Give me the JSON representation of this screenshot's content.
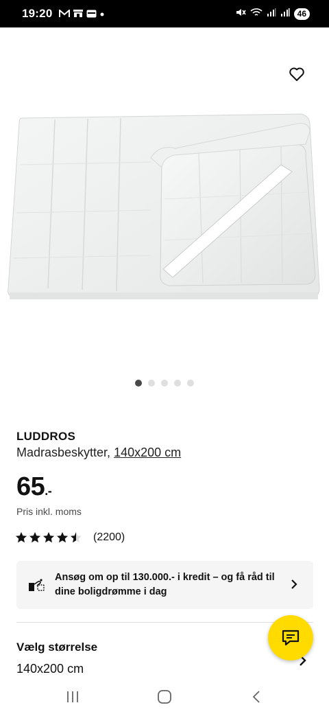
{
  "status_bar": {
    "time": "19:20",
    "notification_icons": [
      "gmail-icon",
      "store-icon",
      "wallet-icon",
      "dot-icon"
    ],
    "battery": "46"
  },
  "product": {
    "favorite_icon": "heart-outline-icon",
    "carousel": {
      "total": 5,
      "active_index": 0
    },
    "brand": "LUDDROS",
    "description_prefix": "Madrasbeskytter,",
    "size_link": "140x200 cm",
    "price": "65",
    "price_suffix": ".-",
    "vat_note": "Pris inkl. moms",
    "rating": {
      "value": 4.5,
      "max": 5,
      "count": "(2200)"
    }
  },
  "credit_banner": {
    "icon": "credit-icon",
    "text": "Ansøg om op til 130.000.- i kredit – og få råd til dine boligdrømme i dag"
  },
  "size_selector": {
    "heading": "Vælg størrelse",
    "value": "140x200 cm"
  },
  "chat": {
    "icon": "chat-icon",
    "color": "#ffdb00"
  },
  "nav_bar": {
    "buttons": [
      "recents-icon",
      "home-icon",
      "back-icon"
    ]
  }
}
